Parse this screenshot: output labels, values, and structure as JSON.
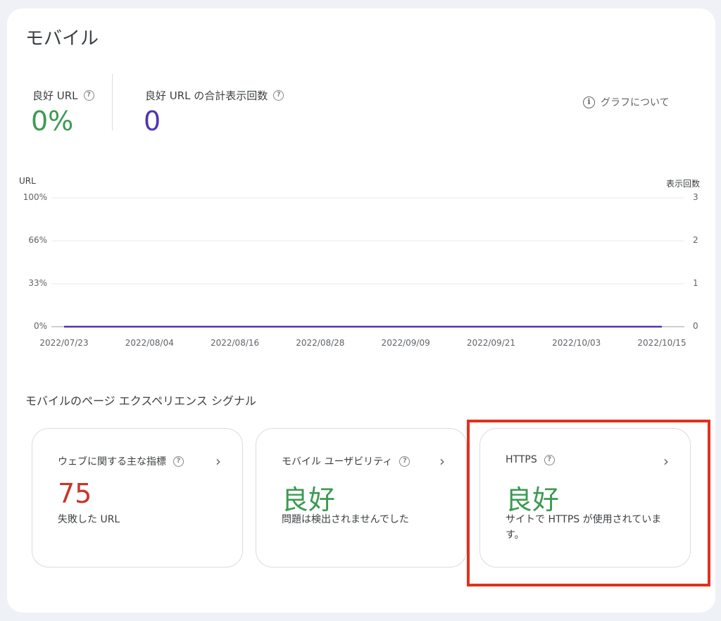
{
  "colors": {
    "good": "#3c9a52",
    "impressions": "#5134b0",
    "poor": "#c5372c",
    "highlight": "#e0321c"
  },
  "panel": {
    "title": "モバイル",
    "about_label": "グラフについて",
    "about_icon": "info-icon"
  },
  "metrics": [
    {
      "label": "良好 URL",
      "value": "0%"
    },
    {
      "label": "良好 URL の合計表示回数",
      "value": "0"
    }
  ],
  "chart_data": {
    "type": "line",
    "left_axis_title": "URL",
    "right_axis_title": "表示回数",
    "left_ticks": [
      "100%",
      "66%",
      "33%",
      "0%"
    ],
    "right_ticks": [
      "3",
      "2",
      "1",
      "0"
    ],
    "x": [
      "2022/07/23",
      "2022/08/04",
      "2022/08/16",
      "2022/08/28",
      "2022/09/09",
      "2022/09/21",
      "2022/10/03",
      "2022/10/15"
    ],
    "series": [
      {
        "values": [
          0,
          0,
          0,
          0,
          0,
          0,
          0,
          0
        ]
      }
    ],
    "ylim_left": [
      0,
      100
    ],
    "ylim_right": [
      0,
      3
    ],
    "grid": true
  },
  "signals": {
    "section_title": "モバイルのページ エクスペリエンス シグナル",
    "cards": [
      {
        "title": "ウェブに関する主な指標",
        "value": "75",
        "desc": "失敗した URL"
      },
      {
        "title": "モバイル ユーザビリティ",
        "value": "良好",
        "desc": "問題は検出されませんでした"
      },
      {
        "title": "HTTPS",
        "value": "良好",
        "desc": "サイトで HTTPS が使用されています。"
      }
    ]
  }
}
